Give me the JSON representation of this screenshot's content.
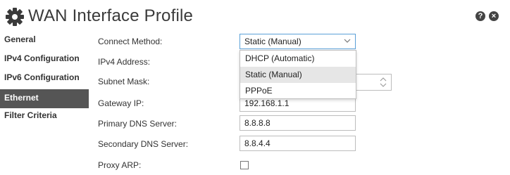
{
  "header": {
    "title": "WAN Interface Profile",
    "help_icon": "?",
    "close_icon": "×"
  },
  "sidebar": {
    "items": [
      {
        "label": "General"
      },
      {
        "label": "IPv4 Configuration"
      },
      {
        "label": "IPv6 Configuration"
      },
      {
        "label": "Ethernet",
        "active": true
      },
      {
        "label": "Filter Criteria"
      }
    ]
  },
  "form": {
    "connect_method": {
      "label": "Connect Method:",
      "value": "Static (Manual)"
    },
    "ipv4_address": {
      "label": "IPv4 Address:"
    },
    "subnet_mask": {
      "label": "Subnet Mask:"
    },
    "gateway_ip": {
      "label": "Gateway IP:",
      "value": "192.168.1.1"
    },
    "primary_dns": {
      "label": "Primary DNS Server:",
      "value": "8.8.8.8"
    },
    "secondary_dns": {
      "label": "Secondary DNS Server:",
      "value": "8.8.4.4"
    },
    "proxy_arp": {
      "label": "Proxy ARP:",
      "checked": false
    }
  },
  "dropdown": {
    "options": [
      "DHCP (Automatic)",
      "Static (Manual)",
      "PPPoE"
    ],
    "selected_index": 1
  },
  "colors": {
    "active_nav_bg": "#555555",
    "select_border": "#5aa0d8"
  }
}
